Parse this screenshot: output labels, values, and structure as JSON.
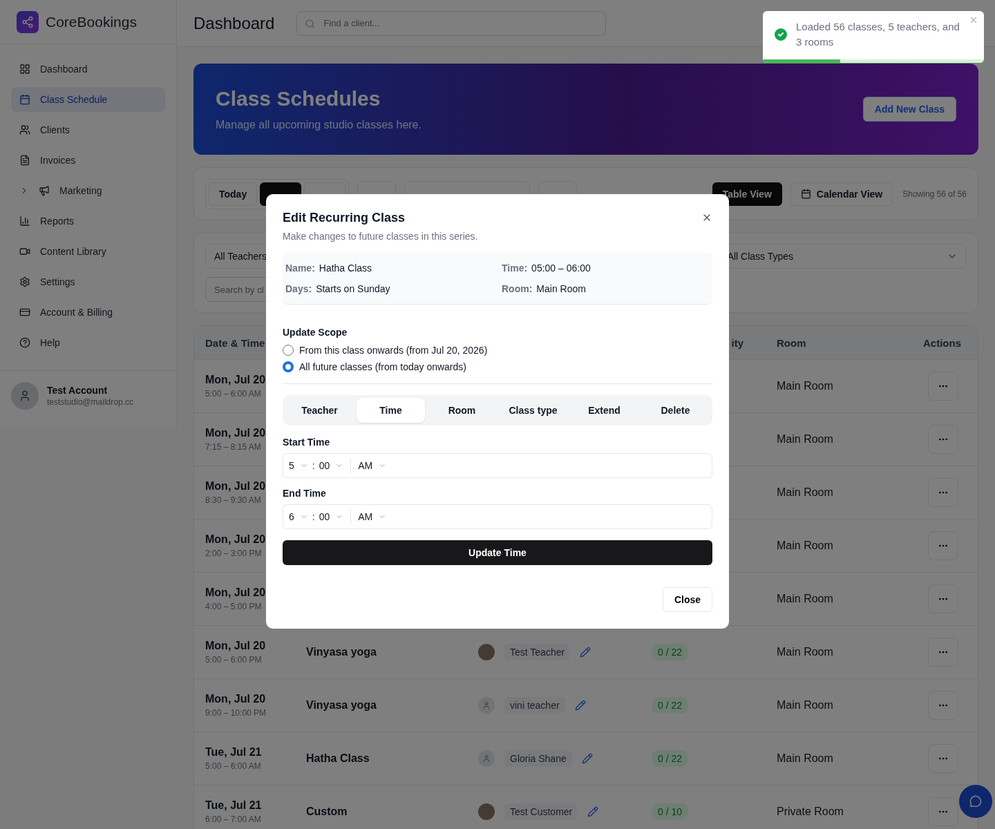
{
  "app": {
    "name": "CoreBookings"
  },
  "sidebar": {
    "items": [
      {
        "label": "Dashboard",
        "selected": false,
        "collapsible": false
      },
      {
        "label": "Class Schedule",
        "selected": true,
        "collapsible": false
      },
      {
        "label": "Clients",
        "selected": false,
        "collapsible": false
      },
      {
        "label": "Invoices",
        "selected": false,
        "collapsible": false
      },
      {
        "label": "Marketing",
        "selected": false,
        "collapsible": true
      },
      {
        "label": "Reports",
        "selected": false,
        "collapsible": false
      },
      {
        "label": "Content Library",
        "selected": false,
        "collapsible": false
      },
      {
        "label": "Settings",
        "selected": false,
        "collapsible": false
      },
      {
        "label": "Account & Billing",
        "selected": false,
        "collapsible": false
      },
      {
        "label": "Help",
        "selected": false,
        "collapsible": false
      }
    ],
    "user": {
      "name": "Test Account",
      "email": "teststudio@maildrop.cc"
    }
  },
  "header": {
    "title": "Dashboard",
    "search": {
      "placeholder": "Find a client..."
    }
  },
  "banner": {
    "title": "Class Schedules",
    "subtitle": "Manage all upcoming studio classes here.",
    "button": "Add New Class"
  },
  "toolbar": {
    "left_buttons": [
      {
        "label": "Today",
        "selected": false
      },
      {
        "selected": true
      },
      {
        "selected": false
      }
    ],
    "views": [
      {
        "label": "Table View",
        "selected": true
      },
      {
        "label": "Calendar View",
        "selected": false
      }
    ],
    "count": "Showing 56 of 56"
  },
  "filters": {
    "teacher": "All Teachers",
    "class_type": "All Class Types",
    "search": {
      "placeholder": "Search by cl"
    }
  },
  "table": {
    "columns": [
      "Date & Time",
      "",
      "",
      "ity",
      "Room",
      "Actions"
    ],
    "rows": [
      {
        "date": "Mon, Jul 20",
        "time": "5:00 – 6:00 AM",
        "room": "Main Room"
      },
      {
        "date": "Mon, Jul 20",
        "time": "7:15 – 8:15 AM",
        "room": "Main Room"
      },
      {
        "date": "Mon, Jul 20",
        "time": "8:30 – 9:30 AM",
        "room": "Main Room"
      },
      {
        "date": "Mon, Jul 20",
        "time": "2:00 – 3:00 PM",
        "room": "Main Room"
      },
      {
        "date": "Mon, Jul 20",
        "time": "4:00 – 5:00 PM",
        "room": "Main Room"
      },
      {
        "date": "Mon, Jul 20",
        "time": "5:00 – 6:00 PM",
        "class": "Vinyasa yoga",
        "teacher": "Test Teacher",
        "kind": "photo",
        "capacity": "0 / 22",
        "room": "Main Room"
      },
      {
        "date": "Mon, Jul 20",
        "time": "9:00 – 10:00 PM",
        "class": "Vinyasa yoga",
        "teacher": "vini teacher",
        "kind": "silhouette",
        "capacity": "0 / 22",
        "room": "Main Room"
      },
      {
        "date": "Tue, Jul 21",
        "time": "5:00 – 6:00 AM",
        "class": "Hatha Class",
        "teacher": "Gloria Shane",
        "kind": "silhouette",
        "capacity": "0 / 22",
        "room": "Main Room"
      },
      {
        "date": "Tue, Jul 21",
        "time": "6:00 – 7:00 AM",
        "class": "Custom",
        "teacher": "Test Customer",
        "kind": "photo",
        "capacity": "0 / 10",
        "room": "Private Room"
      }
    ]
  },
  "modal": {
    "title": "Edit Recurring Class",
    "subtitle": "Make changes to future classes in this series.",
    "info": [
      {
        "label": "Name:",
        "value": "Hatha Class"
      },
      {
        "label": "Time:",
        "value": "05:00 – 06:00"
      },
      {
        "label": "Days:",
        "value": "Starts on Sunday"
      },
      {
        "label": "Room:",
        "value": "Main Room"
      }
    ],
    "scope_label": "Update Scope",
    "scope_options": [
      {
        "label": "From this class onwards (from Jul 20, 2026)",
        "selected": false
      },
      {
        "label": "All future classes (from today onwards)",
        "selected": true
      }
    ],
    "tabs": [
      {
        "label": "Teacher",
        "selected": false
      },
      {
        "label": "Time",
        "selected": true
      },
      {
        "label": "Room",
        "selected": false
      },
      {
        "label": "Class type",
        "selected": false
      },
      {
        "label": "Extend",
        "selected": false
      },
      {
        "label": "Delete",
        "selected": false
      }
    ],
    "times": [
      {
        "label": "Start Time",
        "hour": "5",
        "separator": ":",
        "minute": "00",
        "period": "AM"
      },
      {
        "label": "End Time",
        "hour": "6",
        "separator": ":",
        "minute": "00",
        "period": "AM"
      }
    ],
    "submit": "Update Time",
    "close": "Close"
  },
  "toast": {
    "message": "Loaded 56 classes, 5 teachers, and 3 rooms",
    "level": 0.35
  }
}
